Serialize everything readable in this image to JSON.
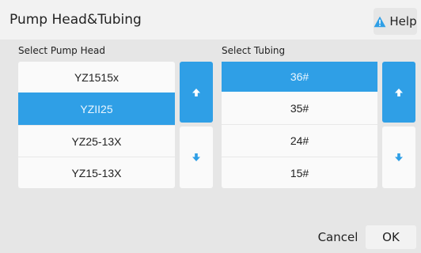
{
  "window": {
    "title": "Pump Head&Tubing",
    "help_label": "Help"
  },
  "pump_head": {
    "label": "Select Pump Head",
    "items": [
      "YZ1515x",
      "YZII25",
      "YZ25-13X",
      "YZ15-13X"
    ],
    "selected": "YZII25"
  },
  "tubing": {
    "label": "Select Tubing",
    "items": [
      "36#",
      "35#",
      "24#",
      "15#"
    ],
    "selected": "36#"
  },
  "footer": {
    "cancel_label": "Cancel",
    "ok_label": "OK"
  },
  "colors": {
    "accent": "#2f9fe6",
    "warning": "#2f9fe6"
  },
  "icons": {
    "help": "warning-triangle",
    "scroll_up": "arrow-up",
    "scroll_down": "arrow-down"
  }
}
